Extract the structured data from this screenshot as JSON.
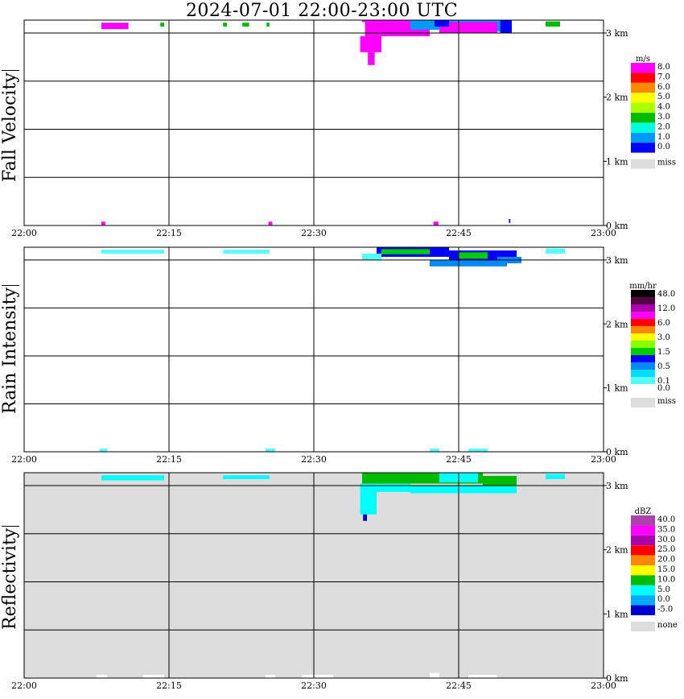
{
  "title": "2024-07-01   22:00-23:00 UTC",
  "colors": {
    "grid": "#000000",
    "none_fill": "#dddddd"
  },
  "chart_data": [
    {
      "type": "heatmap",
      "ylabel": "Fall Velocity",
      "xlabel": "",
      "x_ticks": [
        "22:00",
        "22:15",
        "22:30",
        "22:45",
        "23:00"
      ],
      "y_ticks": [
        "0 km",
        "1 km",
        "2 km",
        "3 km"
      ],
      "ylim_km": [
        0,
        3.2
      ],
      "xlim": [
        "22:00",
        "23:00"
      ],
      "grid": true,
      "background": "#ffffff",
      "scale_unit": "m/s",
      "scale": [
        {
          "label": "8.0",
          "color": "#ff00ff"
        },
        {
          "label": "7.0",
          "color": "#ff0000"
        },
        {
          "label": "6.0",
          "color": "#ff8800"
        },
        {
          "label": "5.0",
          "color": "#ffff00"
        },
        {
          "label": "4.0",
          "color": "#aaff00"
        },
        {
          "label": "3.0",
          "color": "#00bb00"
        },
        {
          "label": "2.0",
          "color": "#00ffdd"
        },
        {
          "label": "1.0",
          "color": "#0099ff"
        },
        {
          "label": "0.0",
          "color": "#0000ff"
        }
      ],
      "missing_label": "miss",
      "regions": [
        {
          "t0": 35.0,
          "t1": 40.0,
          "h0": 3.17,
          "h1": 3.2,
          "color": "#ff00ff"
        },
        {
          "t0": 35.3,
          "t1": 42.0,
          "h0": 2.95,
          "h1": 3.17,
          "color": "#ff00ff"
        },
        {
          "t0": 34.8,
          "t1": 37.0,
          "h0": 2.7,
          "h1": 2.95,
          "color": "#ff00ff"
        },
        {
          "t0": 35.6,
          "t1": 36.3,
          "h0": 2.5,
          "h1": 2.7,
          "color": "#ff00ff"
        },
        {
          "t0": 40.0,
          "t1": 46.0,
          "h0": 3.05,
          "h1": 3.2,
          "color": "#0099ff"
        },
        {
          "t0": 46.0,
          "t1": 49.5,
          "h0": 3.02,
          "h1": 3.2,
          "color": "#0099ff"
        },
        {
          "t0": 43.0,
          "t1": 49.0,
          "h0": 3.0,
          "h1": 3.17,
          "color": "#ff00ff"
        },
        {
          "t0": 49.3,
          "t1": 50.5,
          "h0": 3.0,
          "h1": 3.2,
          "color": "#0000ff"
        },
        {
          "t0": 42.5,
          "t1": 44.0,
          "h0": 3.1,
          "h1": 3.2,
          "color": "#0000ff"
        },
        {
          "t0": 8.0,
          "t1": 10.8,
          "h0": 3.06,
          "h1": 3.16,
          "color": "#ff00ff"
        },
        {
          "t0": 14.1,
          "t1": 14.5,
          "h0": 3.1,
          "h1": 3.16,
          "color": "#00bb00"
        },
        {
          "t0": 20.6,
          "t1": 21.0,
          "h0": 3.1,
          "h1": 3.16,
          "color": "#00bb00"
        },
        {
          "t0": 22.6,
          "t1": 23.3,
          "h0": 3.1,
          "h1": 3.16,
          "color": "#00bb00"
        },
        {
          "t0": 25.1,
          "t1": 25.4,
          "h0": 3.1,
          "h1": 3.16,
          "color": "#00bb00"
        },
        {
          "t0": 54.0,
          "t1": 55.5,
          "h0": 3.1,
          "h1": 3.18,
          "color": "#00bb00"
        },
        {
          "t0": 8.0,
          "t1": 8.4,
          "h0": 0.0,
          "h1": 0.06,
          "color": "#ff00ff"
        },
        {
          "t0": 25.3,
          "t1": 25.7,
          "h0": 0.0,
          "h1": 0.06,
          "color": "#ff00ff"
        },
        {
          "t0": 42.4,
          "t1": 42.9,
          "h0": 0.0,
          "h1": 0.06,
          "color": "#ff00ff"
        },
        {
          "t0": 50.2,
          "t1": 50.35,
          "h0": 0.04,
          "h1": 0.1,
          "color": "#0000ff"
        }
      ]
    },
    {
      "type": "heatmap",
      "ylabel": "Rain Intensity",
      "xlabel": "",
      "x_ticks": [
        "22:00",
        "22:15",
        "22:30",
        "22:45",
        "23:00"
      ],
      "y_ticks": [
        "0 km",
        "1 km",
        "2 km",
        "3 km"
      ],
      "ylim_km": [
        0,
        3.2
      ],
      "xlim": [
        "22:00",
        "23:00"
      ],
      "grid": true,
      "background": "#ffffff",
      "scale_unit": "mm/hr",
      "scale": [
        {
          "label": "48.0",
          "color": "#000000"
        },
        {
          "label": "",
          "color": "#550044"
        },
        {
          "label": "12.0",
          "color": "#aa00aa"
        },
        {
          "label": "",
          "color": "#ff00ff"
        },
        {
          "label": "6.0",
          "color": "#ff0000"
        },
        {
          "label": "",
          "color": "#ff8800"
        },
        {
          "label": "3.0",
          "color": "#ffff00"
        },
        {
          "label": "",
          "color": "#88ff00"
        },
        {
          "label": "1.5",
          "color": "#00cc00"
        },
        {
          "label": "",
          "color": "#0000ff"
        },
        {
          "label": "0.5",
          "color": "#0088ff"
        },
        {
          "label": "",
          "color": "#00ddff"
        },
        {
          "label": "0.1",
          "color": "#55ffff"
        },
        {
          "label": "0.0",
          "color": "#ffffff"
        }
      ],
      "missing_label": "miss",
      "regions": [
        {
          "t0": 36.5,
          "t1": 44.0,
          "h0": 3.05,
          "h1": 3.2,
          "color": "#0000ff"
        },
        {
          "t0": 37.0,
          "t1": 42.0,
          "h0": 3.09,
          "h1": 3.17,
          "color": "#00cc00"
        },
        {
          "t0": 44.0,
          "t1": 51.0,
          "h0": 2.95,
          "h1": 3.15,
          "color": "#0000ff"
        },
        {
          "t0": 45.0,
          "t1": 48.0,
          "h0": 3.02,
          "h1": 3.12,
          "color": "#00cc00"
        },
        {
          "t0": 35.0,
          "t1": 37.0,
          "h0": 3.0,
          "h1": 3.1,
          "color": "#55ffff"
        },
        {
          "t0": 42.0,
          "t1": 50.0,
          "h0": 2.9,
          "h1": 3.0,
          "color": "#0088ff"
        },
        {
          "t0": 49.0,
          "t1": 51.5,
          "h0": 2.95,
          "h1": 3.05,
          "color": "#0088ff"
        },
        {
          "t0": 8.0,
          "t1": 14.5,
          "h0": 3.1,
          "h1": 3.16,
          "color": "#55ffff"
        },
        {
          "t0": 20.6,
          "t1": 25.4,
          "h0": 3.1,
          "h1": 3.16,
          "color": "#55ffff"
        },
        {
          "t0": 54.0,
          "t1": 56.0,
          "h0": 3.1,
          "h1": 3.18,
          "color": "#55ffff"
        },
        {
          "t0": 7.8,
          "t1": 8.6,
          "h0": 0.0,
          "h1": 0.05,
          "color": "#55ffff"
        },
        {
          "t0": 25.0,
          "t1": 26.0,
          "h0": 0.0,
          "h1": 0.05,
          "color": "#55ffff"
        },
        {
          "t0": 42.0,
          "t1": 43.0,
          "h0": 0.0,
          "h1": 0.05,
          "color": "#55ffff"
        },
        {
          "t0": 46.0,
          "t1": 48.0,
          "h0": 0.0,
          "h1": 0.05,
          "color": "#55ffff"
        }
      ]
    },
    {
      "type": "heatmap",
      "ylabel": "Reflectivity",
      "xlabel": "",
      "x_ticks": [
        "22:00",
        "22:15",
        "22:30",
        "22:45",
        "23:00"
      ],
      "y_ticks": [
        "0 km",
        "1 km",
        "2 km",
        "3 km"
      ],
      "ylim_km": [
        0,
        3.2
      ],
      "xlim": [
        "22:00",
        "23:00"
      ],
      "grid": true,
      "background": "#dddddd",
      "scale_unit": "dBZ",
      "scale": [
        {
          "label": "40.0",
          "color": "#aa44aa"
        },
        {
          "label": "35.0",
          "color": "#ff00ff"
        },
        {
          "label": "30.0",
          "color": "#aa00aa"
        },
        {
          "label": "25.0",
          "color": "#ff0000"
        },
        {
          "label": "20.0",
          "color": "#ff8800"
        },
        {
          "label": "15.0",
          "color": "#ffff00"
        },
        {
          "label": "10.0",
          "color": "#00bb00"
        },
        {
          "label": "5.0",
          "color": "#00ffff"
        },
        {
          "label": "0.0",
          "color": "#00aaff"
        },
        {
          "label": "-5.0",
          "color": "#0000cc"
        }
      ],
      "missing_label": "none",
      "regions": [
        {
          "t0": 35.0,
          "t1": 47.5,
          "h0": 3.03,
          "h1": 3.2,
          "color": "#00bb00"
        },
        {
          "t0": 47.5,
          "t1": 51.0,
          "h0": 2.95,
          "h1": 3.15,
          "color": "#00bb00"
        },
        {
          "t0": 34.8,
          "t1": 36.5,
          "h0": 2.55,
          "h1": 3.03,
          "color": "#00ffff"
        },
        {
          "t0": 36.5,
          "t1": 40.0,
          "h0": 2.9,
          "h1": 3.03,
          "color": "#00ffff"
        },
        {
          "t0": 40.0,
          "t1": 51.0,
          "h0": 2.88,
          "h1": 3.0,
          "color": "#00ffff"
        },
        {
          "t0": 43.0,
          "t1": 47.0,
          "h0": 3.05,
          "h1": 3.2,
          "color": "#00ffff"
        },
        {
          "t0": 35.1,
          "t1": 35.5,
          "h0": 2.45,
          "h1": 2.55,
          "color": "#0000cc"
        },
        {
          "t0": 8.0,
          "t1": 14.5,
          "h0": 3.08,
          "h1": 3.16,
          "color": "#00ffff"
        },
        {
          "t0": 20.6,
          "t1": 25.4,
          "h0": 3.1,
          "h1": 3.16,
          "color": "#00ffff"
        },
        {
          "t0": 54.0,
          "t1": 56.0,
          "h0": 3.1,
          "h1": 3.18,
          "color": "#00ffff"
        },
        {
          "t0": 7.5,
          "t1": 8.6,
          "h0": 0.0,
          "h1": 0.05,
          "color": "#ffffff"
        },
        {
          "t0": 12.3,
          "t1": 14.5,
          "h0": 0.0,
          "h1": 0.05,
          "color": "#ffffff"
        },
        {
          "t0": 25.0,
          "t1": 26.0,
          "h0": 0.0,
          "h1": 0.05,
          "color": "#ffffff"
        },
        {
          "t0": 28.8,
          "t1": 32.0,
          "h0": 0.0,
          "h1": 0.05,
          "color": "#ffffff"
        },
        {
          "t0": 42.0,
          "t1": 43.0,
          "h0": 0.0,
          "h1": 0.08,
          "color": "#ffffff"
        },
        {
          "t0": 46.0,
          "t1": 49.0,
          "h0": 0.0,
          "h1": 0.05,
          "color": "#ffffff"
        }
      ]
    }
  ]
}
